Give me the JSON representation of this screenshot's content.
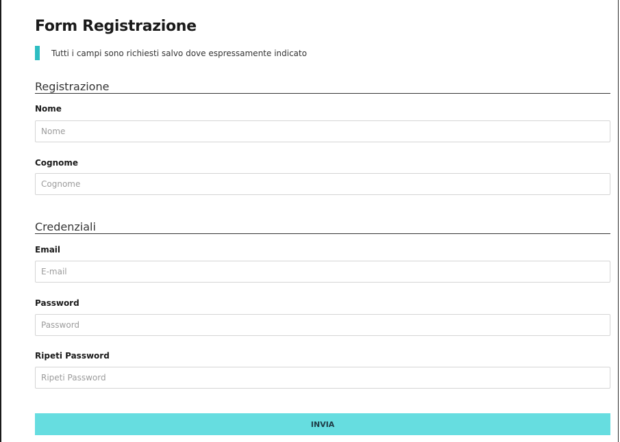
{
  "form": {
    "title": "Form Registrazione",
    "note": "Tutti i campi sono richiesti salvo dove espressamente indicato"
  },
  "sections": {
    "registrazione": {
      "title": "Registrazione",
      "fields": {
        "nome": {
          "label": "Nome",
          "placeholder": "Nome",
          "value": ""
        },
        "cognome": {
          "label": "Cognome",
          "placeholder": "Cognome",
          "value": ""
        }
      }
    },
    "credenziali": {
      "title": "Credenziali",
      "fields": {
        "email": {
          "label": "Email",
          "placeholder": "E-mail",
          "value": ""
        },
        "password": {
          "label": "Password",
          "placeholder": "Password",
          "value": ""
        },
        "ripeti_password": {
          "label": "Ripeti Password",
          "placeholder": "Ripeti Password",
          "value": ""
        }
      }
    }
  },
  "submit": {
    "label": "INVIA"
  },
  "colors": {
    "accent": "#2dbdc2",
    "button_bg": "#66dde0",
    "button_text": "#1e3b45",
    "input_border": "#d4d4d4"
  }
}
